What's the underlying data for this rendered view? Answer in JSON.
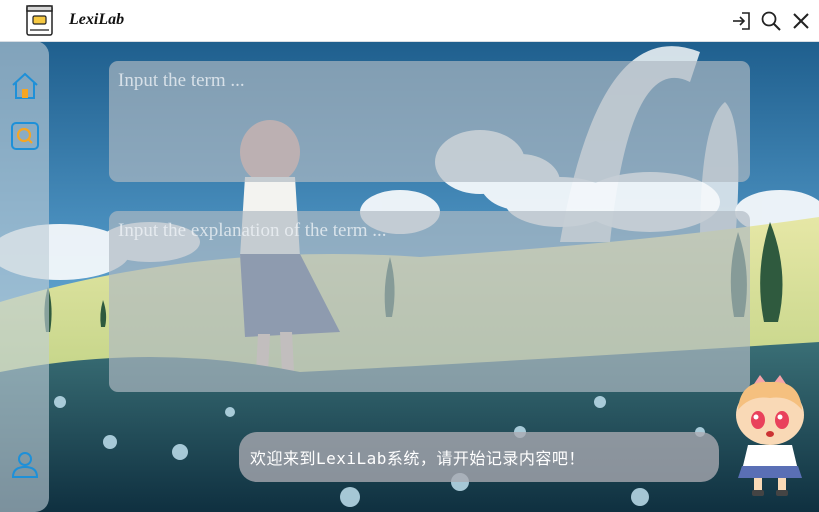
{
  "app": {
    "title": "LexiLab"
  },
  "toolbar": {
    "login_icon": "login-arrow-icon",
    "search_icon": "search-icon",
    "close_icon": "close-icon"
  },
  "sidebar": {
    "items": [
      {
        "icon": "home-icon"
      },
      {
        "icon": "search-icon"
      },
      {
        "icon": "user-icon"
      }
    ],
    "accent": "#1e90d8"
  },
  "form": {
    "term_placeholder": "Input the term ...",
    "explanation_placeholder": "Input the explanation of the term ..."
  },
  "welcome": {
    "message": "欢迎来到LexiLab系统，请开始记录内容吧！"
  },
  "colors": {
    "accent": "#1e90d8",
    "logo_yellow": "#f5c842"
  }
}
